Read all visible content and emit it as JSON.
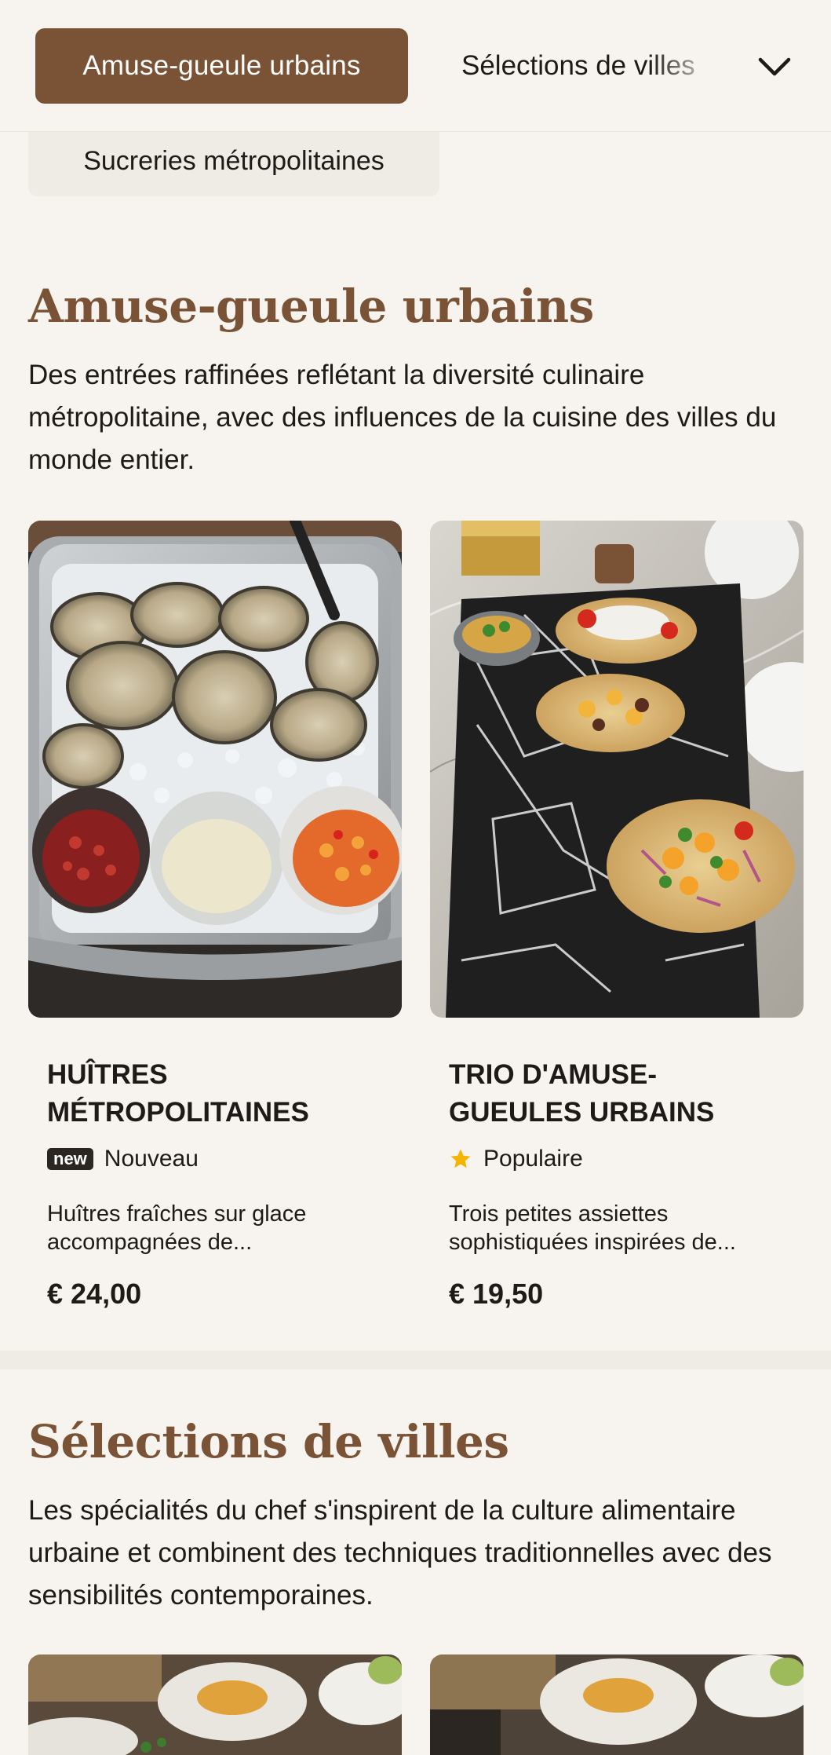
{
  "nav": {
    "active_category": "Amuse-gueule urbains",
    "next_category": "Sélections de villes",
    "expand_icon": "chevron-down-icon",
    "second_row_category": "Sucreries métropolitaines"
  },
  "sections": [
    {
      "title": "Amuse-gueule urbains",
      "description": "Des entrées raffinées reflétant la diversité culinaire métropolitaine, avec des influences de la cuisine des villes du monde entier.",
      "items": [
        {
          "name": "HUÎTRES MÉTROPOLITAINES",
          "badge": "new",
          "tag": "Nouveau",
          "description": "Huîtres fraîches sur glace accompagnées de...",
          "price": "€ 24,00",
          "image": "oysters-on-ice-photo"
        },
        {
          "name": "TRIO D'AMUSE-GUEULES URBAINS",
          "tag_icon": "star-icon",
          "tag": "Populaire",
          "description": "Trois petites assiettes sophistiquées inspirées de...",
          "price": "€ 19,50",
          "image": "tostadas-on-map-board-photo"
        }
      ]
    },
    {
      "title": "Sélections de villes",
      "description": "Les spécialités du chef s'inspirent de la culture alimentaire urbaine et combinent des techniques traditionnelles avec des sensibilités contemporaines."
    }
  ],
  "colors": {
    "accent": "#7a5336",
    "background": "#f7f4ef",
    "star": "#f4b400",
    "text": "#1d1a17"
  }
}
